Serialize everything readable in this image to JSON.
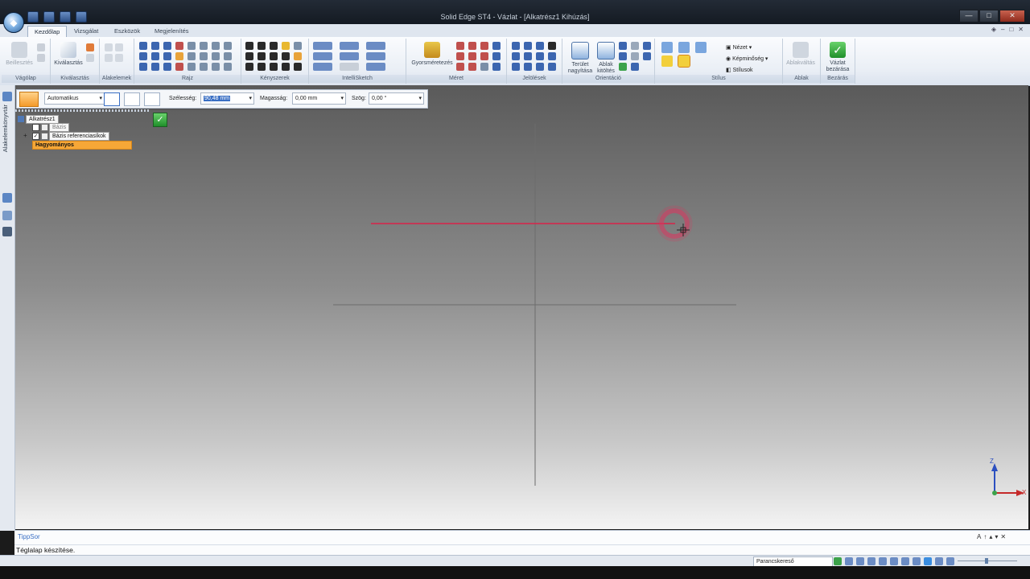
{
  "window": {
    "title": "Solid Edge ST4 - Vázlat - [Alkatrész1 Kihúzás]",
    "minimize": "—",
    "maximize": "□",
    "close": "✕"
  },
  "tabs": [
    "Kezdőlap",
    "Vizsgálat",
    "Eszközök",
    "Megjelenítés"
  ],
  "ribbon": {
    "groups": {
      "clipboard": {
        "label": "Vágólap",
        "paste": "Beillesztés"
      },
      "select": {
        "label": "Kiválasztás",
        "button": "Kiválasztás"
      },
      "elements": {
        "label": "Alakelemek"
      },
      "draw": {
        "label": "Rajz"
      },
      "constraints": {
        "label": "Kényszerek"
      },
      "intellisketch": {
        "label": "IntelliSketch"
      },
      "dimension": {
        "label": "Méret",
        "button": "Gyorsméretezés"
      },
      "annotations": {
        "label": "Jelölések"
      },
      "orient": {
        "label": "Orientáció",
        "zoom_area": "Terület nagyítása",
        "fit": "Ablak kitöltés"
      },
      "style": {
        "label": "Stílus",
        "view": "Nézet",
        "render": "Képminőség",
        "styles": "Stílusok"
      },
      "window": {
        "label": "Ablak",
        "switch": "Ablakváltás"
      },
      "close": {
        "label": "Bezárás",
        "button": "Vázlat bezárása"
      }
    }
  },
  "commandbar": {
    "mode": "Automatikus",
    "width_label": "Szélesség:",
    "width_value": "90,48 mm",
    "height_label": "Magasság:",
    "height_value": "0,00 mm",
    "angle_label": "Szög:",
    "angle_value": "0,00 °"
  },
  "sidebar": {
    "label": "Alakelemkönyvtár"
  },
  "tree": {
    "root": "Alkatrész1",
    "items": [
      {
        "label": "Bázis",
        "checked": false
      },
      {
        "label": "Bázis referenciasíkok",
        "checked": true
      },
      {
        "label": "Hagyományos",
        "highlighted": true
      }
    ]
  },
  "triad": {
    "z": "Z",
    "x": "X"
  },
  "prompt": {
    "title": "TippSor",
    "text": "Téglalap készítése."
  },
  "statusbar": {
    "command_finder": "Parancskereső"
  },
  "colors": {
    "sketch_line": "#d9234a",
    "accent": "#f6a737"
  }
}
